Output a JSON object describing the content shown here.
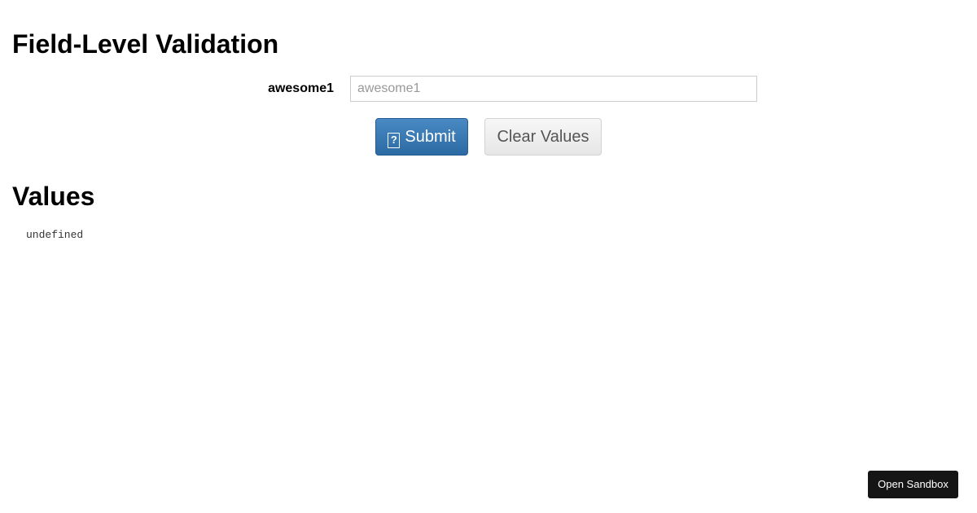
{
  "form": {
    "title": "Field-Level Validation",
    "field": {
      "label": "awesome1",
      "value": "",
      "placeholder": "awesome1"
    },
    "submit": {
      "icon": "question-box-icon",
      "icon_glyph": "?",
      "label": "Submit"
    },
    "clear_label": "Clear Values"
  },
  "values": {
    "title": "Values",
    "output": "undefined"
  },
  "sandbox": {
    "label": "Open Sandbox"
  },
  "colors": {
    "primary": "#337ab7",
    "sandbox_bg": "#151515"
  }
}
